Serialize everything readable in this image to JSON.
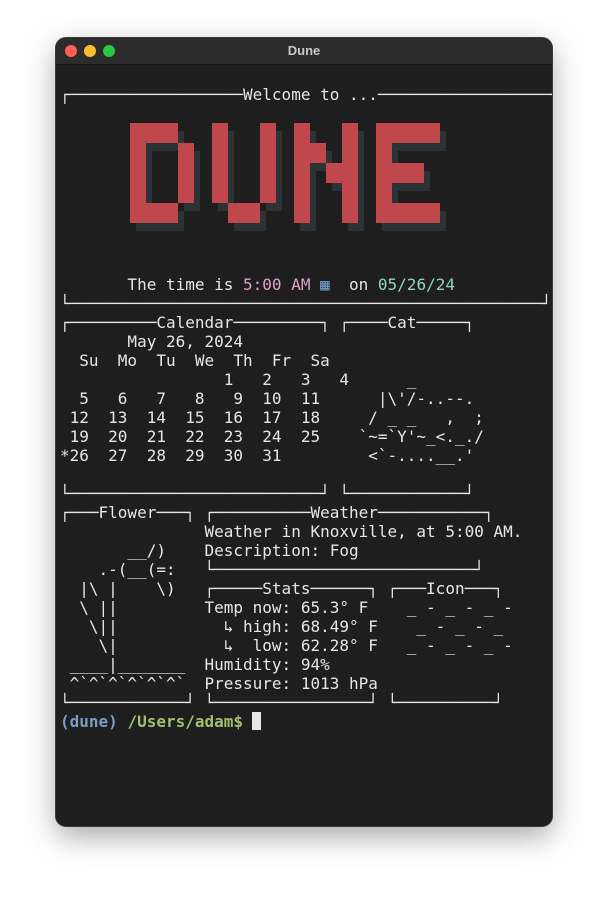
{
  "window": {
    "title": "Dune",
    "controls": [
      "close",
      "minimize",
      "zoom"
    ]
  },
  "logo_text": "DUNE",
  "time_icon": "clock-emoji-icon",
  "terminal_lines": [
    {
      "row": 0,
      "segs": [
        {
          "t": "┌──────────────────Welcome to ...──────────────────┐"
        }
      ]
    },
    {
      "row": 10,
      "segs": [
        {
          "t": "       The time is "
        },
        {
          "t": "5:00 AM",
          "c": "#e0a3c7"
        },
        {
          "t": " ▦ ",
          "c": "#6f9ec9"
        },
        {
          "t": " on "
        },
        {
          "t": "05/26/24",
          "c": "#8fd6bf"
        }
      ]
    },
    {
      "row": 11,
      "segs": [
        {
          "t": "└─────────────────────────────────────────────────┘"
        }
      ]
    },
    {
      "row": 12,
      "segs": [
        {
          "t": "┌─────────Calendar─────────┐ ┌────Cat─────┐"
        }
      ]
    },
    {
      "row": 13,
      "segs": [
        {
          "t": "       May 26, 2024"
        }
      ]
    },
    {
      "row": 14,
      "segs": [
        {
          "t": "  Su  Mo  Tu  We  Th  Fr  Sa"
        }
      ]
    },
    {
      "row": 15,
      "segs": [
        {
          "t": "                 1   2   3   4      _"
        }
      ]
    },
    {
      "row": 16,
      "segs": [
        {
          "t": "  5   6   7   8   9  10  11      |\\'/-..--."
        }
      ]
    },
    {
      "row": 17,
      "segs": [
        {
          "t": " 12  13  14  15  16  17  18     / _ _   ,  ;"
        }
      ]
    },
    {
      "row": 18,
      "segs": [
        {
          "t": " 19  20  21  22  23  24  25    `~=`Y'~_<._./"
        }
      ]
    },
    {
      "row": 19,
      "segs": [
        {
          "t": "*26  27  28  29  30  31         <`-....__.'"
        }
      ]
    },
    {
      "row": 21,
      "segs": [
        {
          "t": "└──────────────────────────┘ └────────────┘"
        }
      ]
    },
    {
      "row": 22,
      "segs": [
        {
          "t": "┌───Flower───┐ ┌──────────Weather───────────┐"
        }
      ]
    },
    {
      "row": 23,
      "segs": [
        {
          "t": "               Weather in Knoxville, at 5:00 AM."
        }
      ]
    },
    {
      "row": 24,
      "segs": [
        {
          "t": "       __/)    Description: Fog"
        }
      ]
    },
    {
      "row": 25,
      "segs": [
        {
          "t": "    .-(__(=:   └───────────────────────────┘"
        }
      ]
    },
    {
      "row": 26,
      "segs": [
        {
          "t": "  |\\ |    \\)   ┌─────Stats──────┐ ┌───Icon───┐"
        }
      ]
    },
    {
      "row": 27,
      "segs": [
        {
          "t": "  \\ ||         Temp now: 65.3° F    _ - _ - _ -"
        }
      ]
    },
    {
      "row": 28,
      "segs": [
        {
          "t": "   \\||           ↳ high: 68.49° F    _ - _ - _"
        }
      ]
    },
    {
      "row": 29,
      "segs": [
        {
          "t": "    \\|           ↳  low: 62.28° F   _ - _ - _ -"
        }
      ]
    },
    {
      "row": 30,
      "segs": [
        {
          "t": " ____|_______  Humidity: 94%"
        }
      ]
    },
    {
      "row": 31,
      "segs": [
        {
          "t": " ^`^`^`^`^`^`  Pressure: 1013 hPa"
        }
      ]
    },
    {
      "row": 32,
      "segs": [
        {
          "t": "└────────────┘ └────────────────┘ └──────────┘"
        }
      ]
    },
    {
      "row": 33,
      "segs": [
        {
          "t": "(dune)",
          "c": "#7a9ec2",
          "b": true
        },
        {
          "t": " "
        },
        {
          "t": "/Users/adam$",
          "c": "#a6bf6e",
          "b": true
        },
        {
          "t": " "
        }
      ]
    }
  ],
  "colors": {
    "terminal_bg": "#1e1e1e",
    "logo_red": "#c0474b",
    "logo_shadow": "#2c3337",
    "time": "#e0a3c7",
    "date": "#8fd6bf",
    "prompt_env": "#7a9ec2",
    "prompt_path": "#a6bf6e"
  }
}
